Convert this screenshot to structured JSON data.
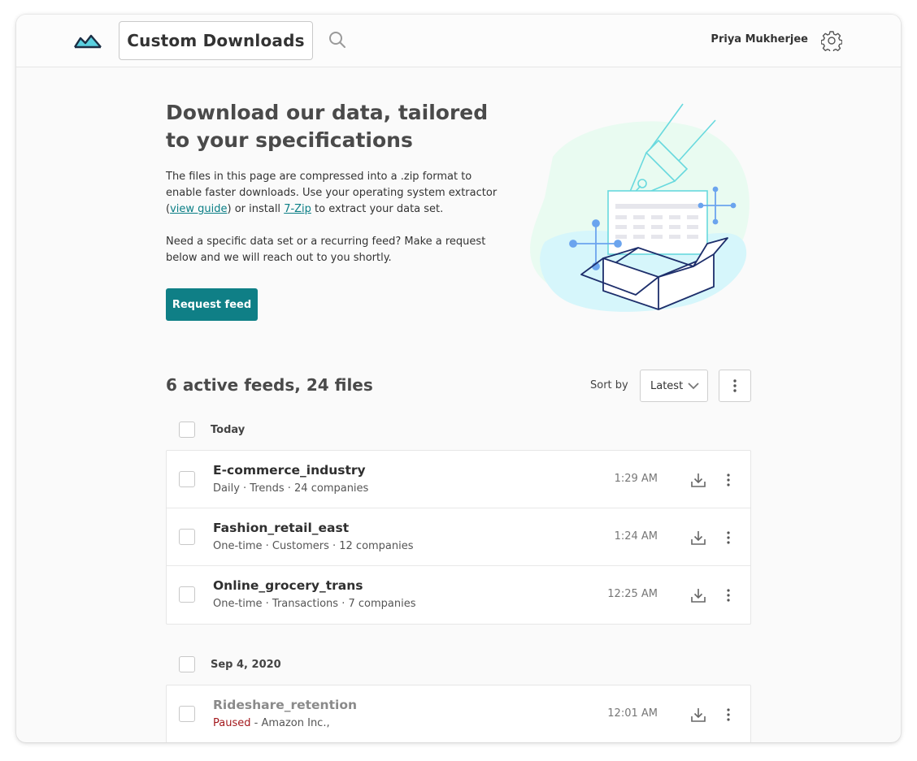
{
  "header": {
    "title": "Custom Downloads",
    "user_name": "Priya Mukherjee"
  },
  "hero": {
    "heading": "Download our data, tailored to your specifications",
    "desc_part1": "The files in this page are compressed into a .zip format to enable faster downloads. Use your operating system extractor (",
    "view_guide_link": "view guide",
    "desc_part2": ") or install ",
    "sevenzip_link": "7-Zip",
    "desc_part3": " to extract your data set.",
    "request_text": "Need a specific data set or a recurring feed? Make a request below and we will reach out to you shortly.",
    "request_button": "Request feed"
  },
  "feeds": {
    "summary": "6 active feeds, 24 files",
    "sort_label": "Sort by",
    "sort_value": "Latest",
    "groups": [
      {
        "label": "Today",
        "rows": [
          {
            "name": "E-commerce_industry",
            "meta": "Daily · Trends · 24 companies",
            "time": "1:29 AM"
          },
          {
            "name": "Fashion_retail_east",
            "meta": "One-time · Customers · 12 companies",
            "time": "1:24 AM"
          },
          {
            "name": "Online_grocery_trans",
            "meta": "One-time · Transactions · 7 companies",
            "time": "12:25 AM"
          }
        ]
      },
      {
        "label": "Sep 4, 2020",
        "rows": [
          {
            "name": "Rideshare_retention",
            "status": "Paused",
            "meta": " - Amazon Inc.,",
            "time": "12:01 AM"
          }
        ]
      }
    ]
  },
  "colors": {
    "accent": "#0f7f86",
    "paused": "#a3191d"
  },
  "icons": [
    "logo-icon",
    "search-icon",
    "gear-icon",
    "chevron-down-icon",
    "more-vertical-icon",
    "download-icon"
  ]
}
